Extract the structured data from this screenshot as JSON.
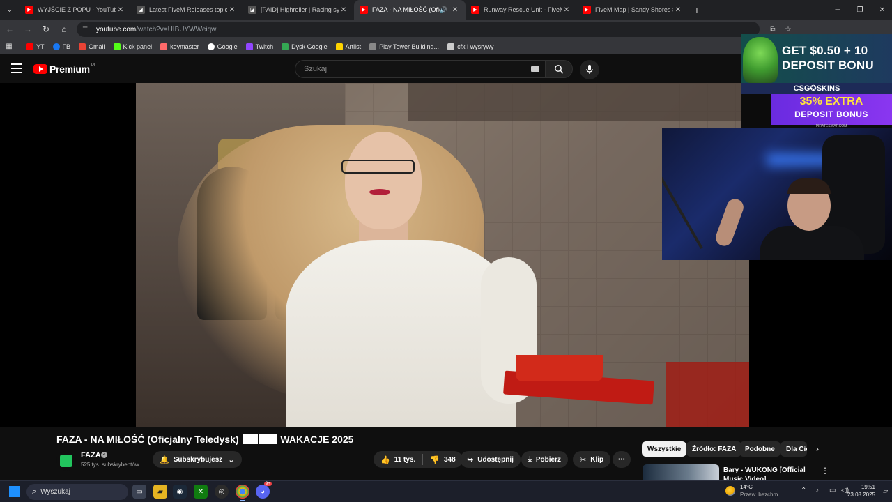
{
  "browser": {
    "tabs": [
      {
        "title": "WYJŚCIE Z POPU - YouTube",
        "favicon": "youtube-icon",
        "active": false
      },
      {
        "title": "Latest FiveM Releases topics - C",
        "favicon": "cfx-icon",
        "active": false
      },
      {
        "title": "[PAID] Highroller | Racing syste",
        "favicon": "cfx-icon",
        "active": false
      },
      {
        "title": "FAZA - NA MIŁOŚĆ (Oficjaln",
        "favicon": "youtube-icon",
        "active": true
      },
      {
        "title": "Runway Rescue Unit - FiveM Ve",
        "favicon": "youtube-icon",
        "active": false
      },
      {
        "title": "FiveM Map | Sandy Shores Stat",
        "favicon": "youtube-icon",
        "active": false
      }
    ],
    "address": {
      "host": "youtube.com",
      "path": "/watch?v=UIBUYWWeiqw"
    },
    "bookmarks": [
      {
        "label": "YT",
        "color": "#ff0000"
      },
      {
        "label": "FB",
        "color": "#1877f2"
      },
      {
        "label": "Gmail",
        "color": "#ea4335"
      },
      {
        "label": "Kick panel",
        "color": "#53fc18"
      },
      {
        "label": "keymaster",
        "color": "#ff6a6a"
      },
      {
        "label": "Google",
        "color": "#ffffff"
      },
      {
        "label": "Twitch",
        "color": "#9146ff"
      },
      {
        "label": "Dysk Google",
        "color": "#34a853"
      },
      {
        "label": "Artlist",
        "color": "#ffd400"
      },
      {
        "label": "Play Tower Building...",
        "color": "#888888"
      },
      {
        "label": "cfx i wysrywy",
        "color": "#cccccc"
      }
    ]
  },
  "youtube": {
    "logo_word": "Premium",
    "logo_region": "PL",
    "search_placeholder": "Szukaj",
    "video_title_part1": "FAZA - NA MIŁOŚĆ (Oficjalny Teledysk)",
    "video_title_part2": "WAKACJE 2025",
    "channel": {
      "name": "FAZA",
      "subscribers": "525 tys. subskrybentów",
      "subscribe_label": "Subskrybujesz"
    },
    "actions": {
      "likes": "11 tys.",
      "dislikes": "348",
      "share": "Udostępnij",
      "download": "Pobierz",
      "clip": "Klip",
      "more": "⋯"
    },
    "chips": [
      "Wszystkie",
      "Źródło: FAZA",
      "Podobne",
      "Dla Ciebie"
    ],
    "recommendation": {
      "title": "Bary - WUKONG [Official Music Video]"
    }
  },
  "overlay_ad": {
    "line1": "GET $0.50 + 10",
    "line2": "DEPOSIT BONU",
    "brand": "CSG✪SKINS",
    "bonus_line1": "35% EXTRA",
    "bonus_line2": "DEPOSIT BONUS",
    "site": "PIRATESWAP.COM"
  },
  "taskbar": {
    "search_placeholder": "Wyszukaj",
    "weather_temp": "14°C",
    "weather_desc": "Przew. bezchm.",
    "time": "19:51",
    "date": "23.08.2025",
    "discord_badge": "9+"
  },
  "colors": {
    "accent": "#ff0000",
    "background": "#0f0f0f",
    "chip_bg": "#272727"
  }
}
